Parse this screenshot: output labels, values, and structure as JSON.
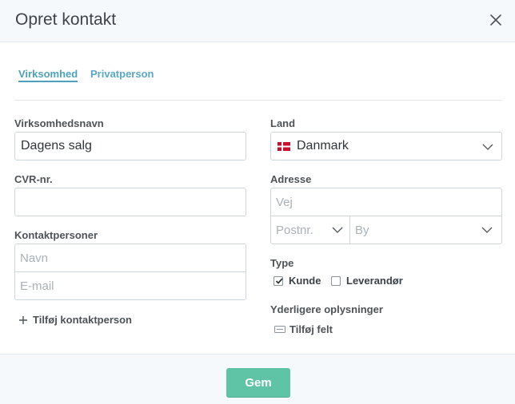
{
  "dialog": {
    "title": "Opret kontakt"
  },
  "tabs": [
    {
      "label": "Virksomhed",
      "active": true
    },
    {
      "label": "Privatperson",
      "active": false
    }
  ],
  "left": {
    "company_name": {
      "label": "Virksomhedsnavn",
      "value": "Dagens salg"
    },
    "cvr": {
      "label": "CVR-nr.",
      "value": ""
    },
    "contacts": {
      "label": "Kontaktpersoner",
      "name_placeholder": "Navn",
      "email_placeholder": "E-mail",
      "add_label": "Tilføj kontaktperson"
    }
  },
  "right": {
    "country": {
      "label": "Land",
      "value": "Danmark",
      "flag": "denmark-flag"
    },
    "address": {
      "label": "Adresse",
      "street_placeholder": "Vej",
      "postal_placeholder": "Postnr.",
      "city_placeholder": "By"
    },
    "type": {
      "label": "Type",
      "options": [
        {
          "label": "Kunde",
          "checked": true
        },
        {
          "label": "Leverandør",
          "checked": false
        }
      ]
    },
    "extra": {
      "label": "Yderligere oplysninger",
      "add_label": "Tilføj felt"
    }
  },
  "footer": {
    "save_label": "Gem"
  },
  "colors": {
    "accent": "#4ca2bd",
    "save": "#5fc4a6",
    "flag_red": "#c8102e"
  }
}
